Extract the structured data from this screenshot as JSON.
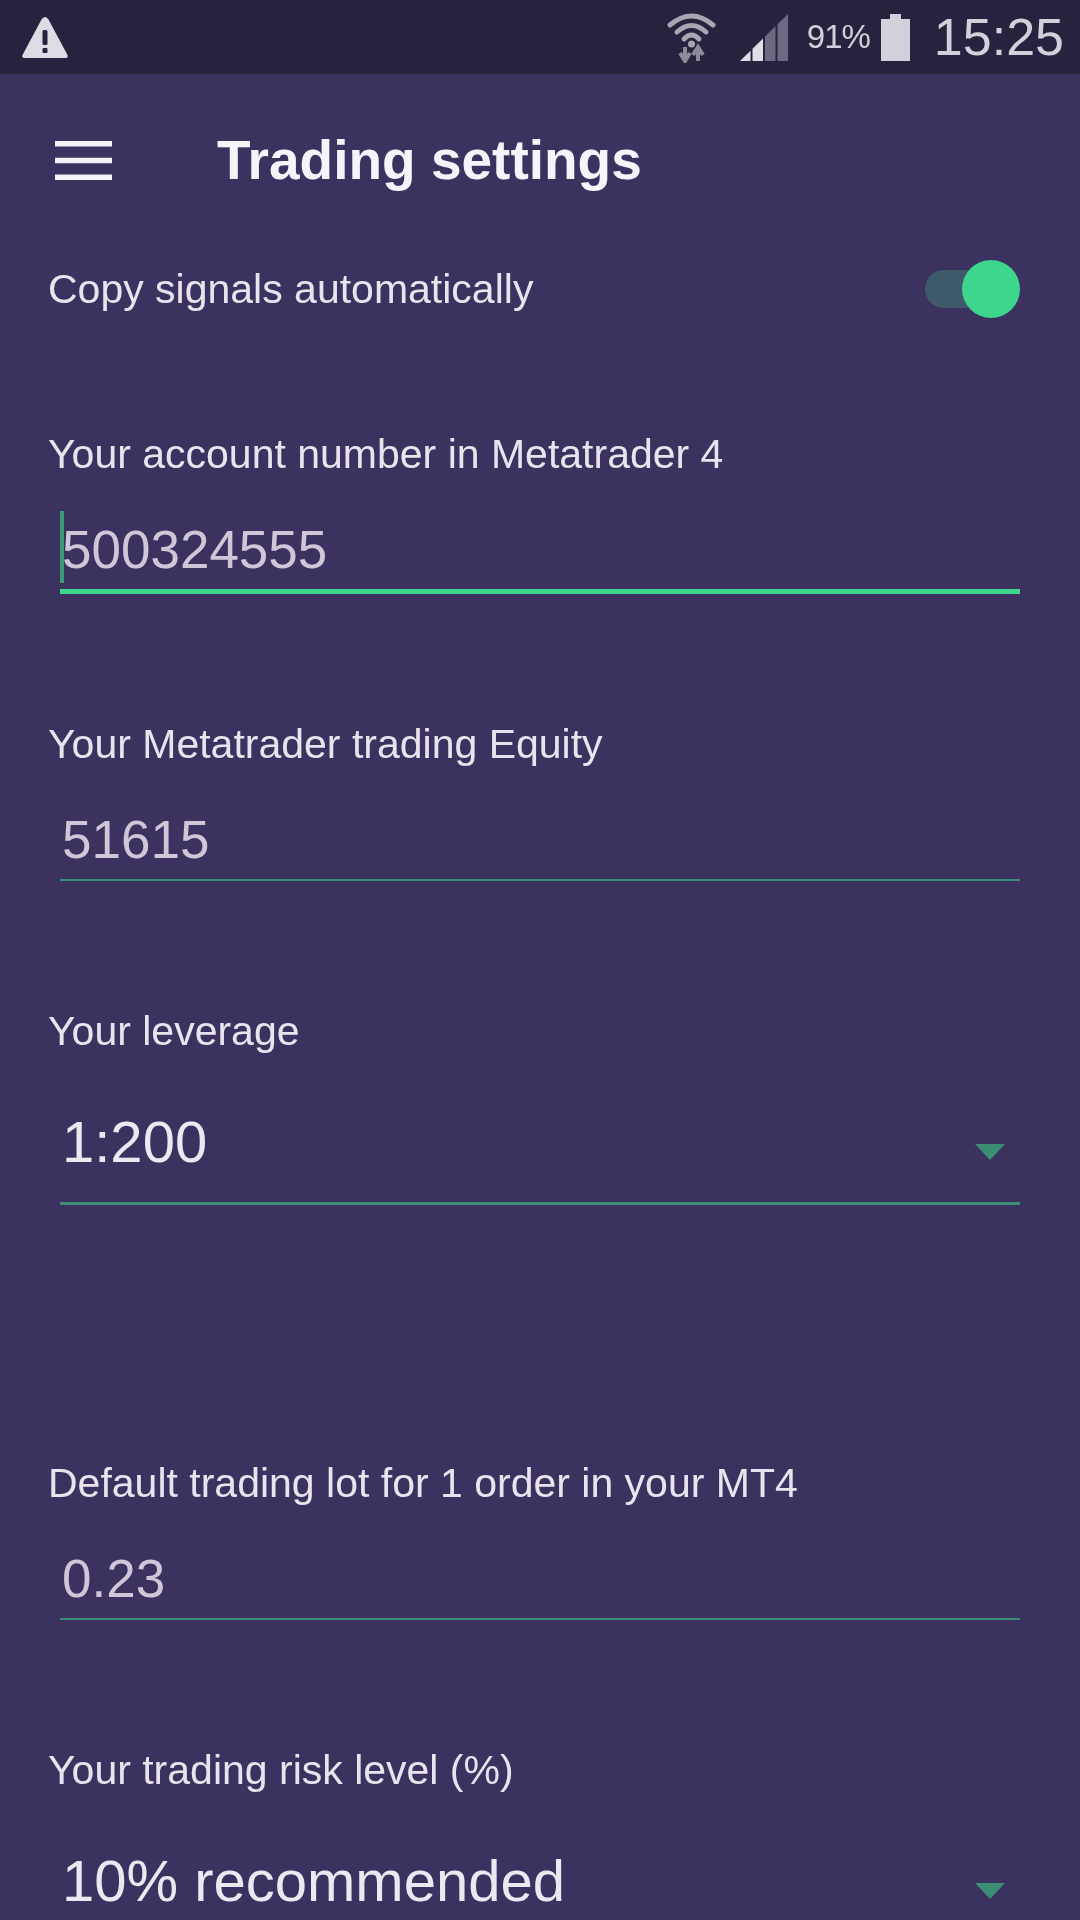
{
  "status_bar": {
    "battery_percent": "91%",
    "time": "15:25"
  },
  "app_bar": {
    "title": "Trading settings"
  },
  "settings": [
    {
      "kind": "toggle",
      "label": "Copy signals automatically",
      "on": true
    },
    {
      "kind": "text",
      "label": "Your account number in Metatrader 4",
      "value": "500324555",
      "focused": true
    },
    {
      "kind": "text",
      "label": "Your Metatrader trading Equity",
      "value": "51615",
      "focused": false
    },
    {
      "kind": "dropdown",
      "label": "Your leverage",
      "value": "1:200"
    },
    {
      "kind": "text",
      "label": "Default trading lot for 1 order in your MT4",
      "value": "0.23",
      "focused": false
    },
    {
      "kind": "dropdown",
      "label": "Your trading risk level (%)",
      "value": "10% recommended"
    }
  ]
}
